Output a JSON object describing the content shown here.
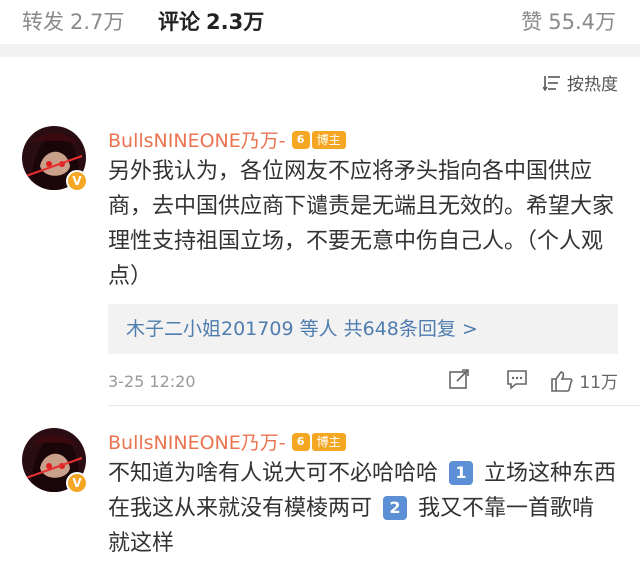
{
  "tabs": {
    "repost": {
      "label": "转发",
      "count": "2.7万"
    },
    "comment": {
      "label": "评论",
      "count": "2.3万"
    },
    "like": {
      "label": "赞",
      "count": "55.4万"
    }
  },
  "sort": {
    "label": "按热度",
    "icon": "sort-icon"
  },
  "comments": [
    {
      "username": "BullsNINEONE乃万-",
      "level": "6",
      "tag": "博主",
      "text": "另外我认为，各位网友不应将矛头指向各中国供应商，去中国供应商下谴责是无端且无效的。希望大家理性支持祖国立场，不要无意中伤自己人。（个人观点）",
      "replies": "木子二小姐201709 等人 共648条回复 >",
      "time": "3-25 12:20",
      "likes": "11万"
    },
    {
      "username": "BullsNINEONE乃万-",
      "level": "6",
      "tag": "博主",
      "text_parts": [
        "不知道为啥有人说大可不必哈哈哈 ",
        "1",
        " 立场这种东西在我这从来就没有模棱两可 ",
        "2",
        " 我又不靠一首歌啃  就这样"
      ]
    }
  ],
  "colors": {
    "username": "#eb7350",
    "link": "#507daf",
    "badge": "#f5a623",
    "numbox": "#5d8fd6"
  }
}
